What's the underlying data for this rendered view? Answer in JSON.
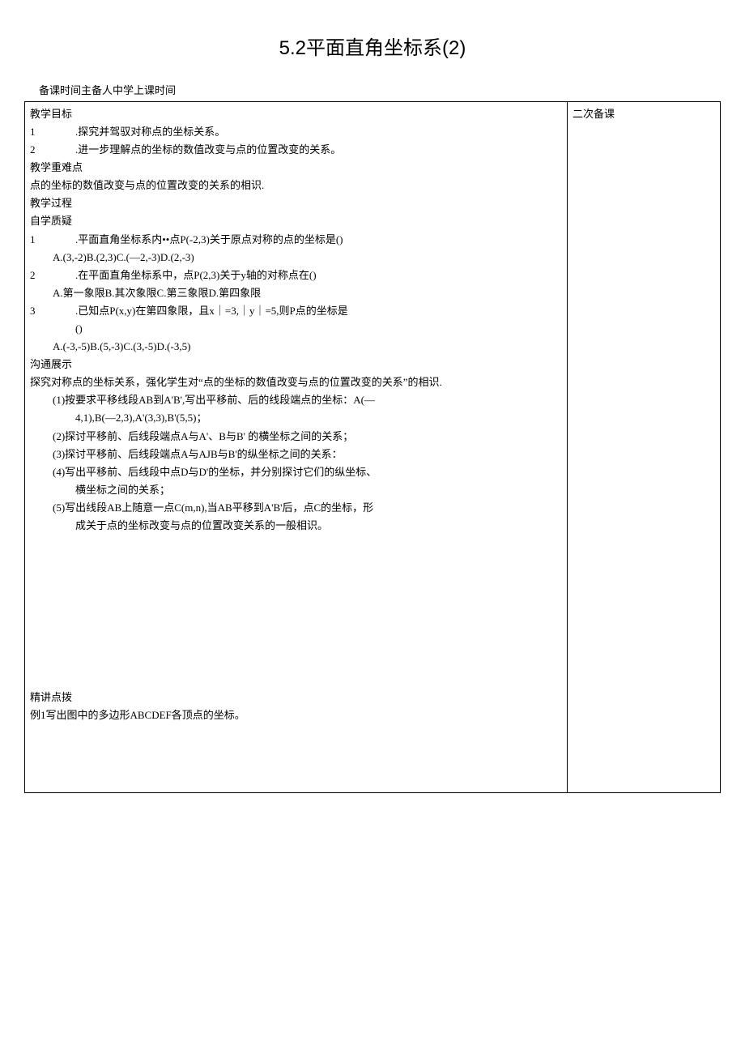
{
  "title": "5.2平面直角坐标系(2)",
  "meta": "备课时间主备人中学上课时间",
  "side_header": "二次备课",
  "sec_goal": "教学目标",
  "goals": [
    {
      "num": "1",
      "txt": ".探究并驾驭对称点的坐标关系。"
    },
    {
      "num": "2",
      "txt": ".进一步理解点的坐标的数值改变与点的位置改变的关系。"
    }
  ],
  "sec_diff": "教学重难点",
  "diff_text": "点的坐标的数值改变与点的位置改变的关系的相识.",
  "sec_process": "教学过程",
  "sec_selfq": "自学质疑",
  "q1": {
    "num": "1",
    "txt": ".平面直角坐标系内••点P(-2,3)关于原点对称的点的坐标是()",
    "opts": "A.(3,-2)B.(2,3)C.(—2,-3)D.(2,-3)"
  },
  "q2": {
    "num": "2",
    "txt": ".在平面直角坐标系中，点P(2,3)关于y轴的对称点在()",
    "opts": "A.第一象限B.其次象限C.第三象限D.第四象限"
  },
  "q3": {
    "num": "3",
    "txt": ".已知点P(x,y)在第四象限，且x｜=3,｜y｜=5,则P点的坐标是",
    "paren": "()",
    "opts": "A.(-3,-5)B.(5,-3)C.(3,-5)D.(-3,5)"
  },
  "sec_comm": "沟通展示",
  "comm_intro": "探究对称点的坐标关系，强化学生对“点的坐标的数值改变与点的位置改变的关系”的相识.",
  "steps": [
    {
      "line1": "(1)按要求平移线段AB到A'B',写出平移前、后的线段端点的坐标：A(—",
      "line2": "4,1),B(—2,3),A'(3,3),B'(5,5)；"
    },
    {
      "line1": "(2)探讨平移前、后线段端点A与A'、B与B' 的横坐标之间的关系；"
    },
    {
      "line1": "(3)探讨平移前、后线段端点A与AJB与B'的纵坐标之间的关系："
    },
    {
      "line1": "(4)写出平移前、后线段中点D与D'的坐标，并分别探讨它们的纵坐标、",
      "line2": "横坐标之间的关系；"
    },
    {
      "line1": "(5)写出线段AB上随意一点C(m,n),当AB平移到A'B'后，点C的坐标，形",
      "line2": "成关于点的坐标改变与点的位置改变关系的一般相识。"
    }
  ],
  "sec_explain": "精讲点拨",
  "example1": "例1写出图中的多边形ABCDEF各顶点的坐标。"
}
